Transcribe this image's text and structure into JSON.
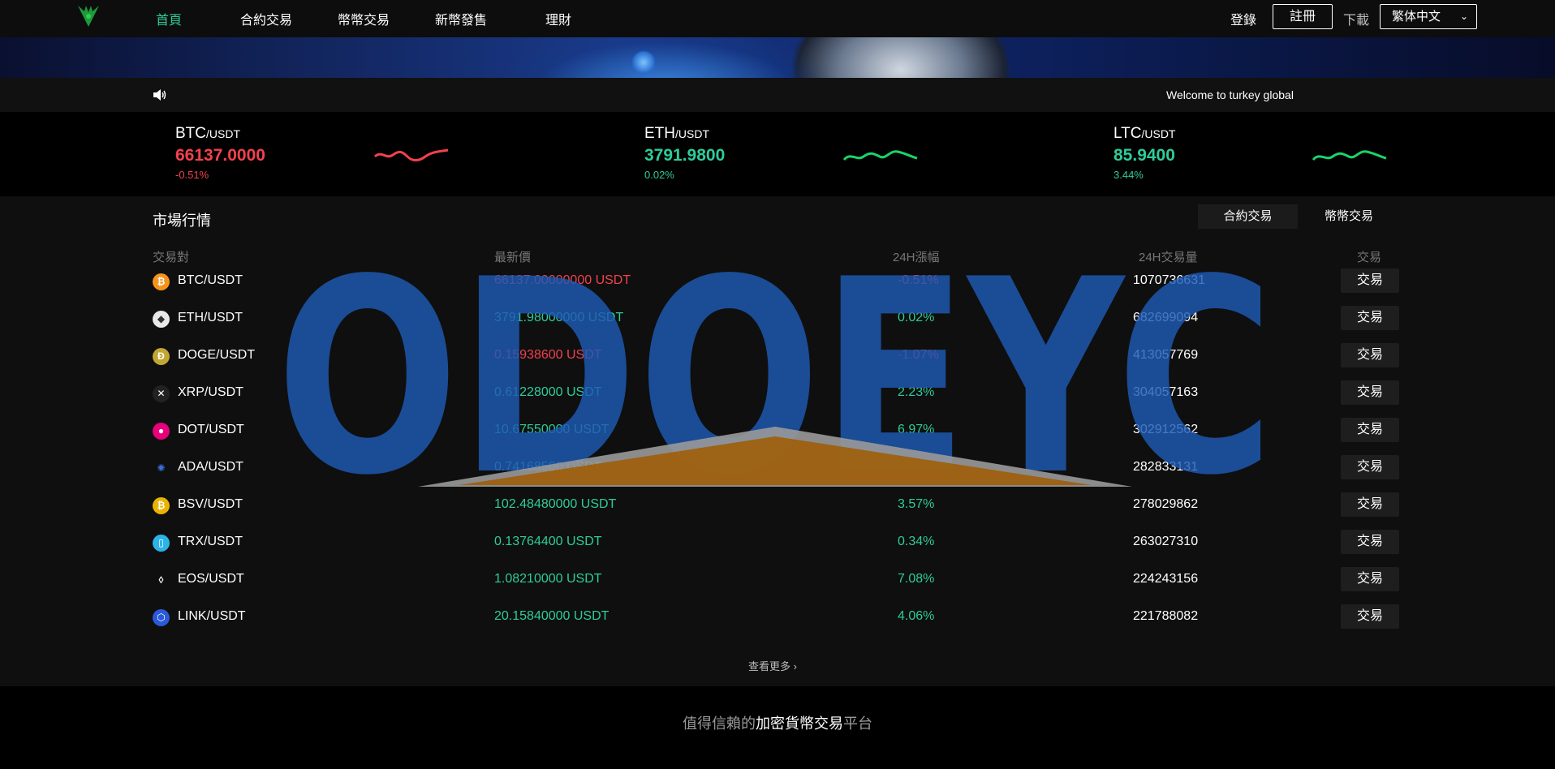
{
  "nav": {
    "items": [
      "首頁",
      "合約交易",
      "幣幣交易",
      "新幣發售",
      "理財"
    ],
    "login": "登錄",
    "register": "註冊",
    "download": "下載",
    "language": "繁体中文"
  },
  "notice": {
    "text": "Welcome to turkey global"
  },
  "tickers": [
    {
      "base": "BTC",
      "quote": "/USDT",
      "price": "66137.0000",
      "change": "-0.51%",
      "trend": "down"
    },
    {
      "base": "ETH",
      "quote": "/USDT",
      "price": "3791.9800",
      "change": "0.02%",
      "trend": "up"
    },
    {
      "base": "LTC",
      "quote": "/USDT",
      "price": "85.9400",
      "change": "3.44%",
      "trend": "up"
    }
  ],
  "market": {
    "title": "市場行情",
    "tabs": [
      "合約交易",
      "幣幣交易"
    ],
    "headers": [
      "交易對",
      "最新價",
      "24H漲幅",
      "24H交易量",
      "交易"
    ],
    "rows": [
      {
        "pair": "BTC/USDT",
        "price": "66137.00000000 USDT",
        "change": "-0.51%",
        "volume": "1070736631",
        "action": "交易",
        "icon": "bitcoin-icon",
        "trend": "down"
      },
      {
        "pair": "ETH/USDT",
        "price": "3791.98000000 USDT",
        "change": "0.02%",
        "volume": "682699094",
        "action": "交易",
        "icon": "ethereum-icon",
        "trend": "up"
      },
      {
        "pair": "DOGE/USDT",
        "price": "0.15938600 USDT",
        "change": "-1.07%",
        "volume": "413057769",
        "action": "交易",
        "icon": "dogecoin-icon",
        "trend": "down"
      },
      {
        "pair": "XRP/USDT",
        "price": "0.61228000 USDT",
        "change": "2.23%",
        "volume": "304057163",
        "action": "交易",
        "icon": "xrp-icon",
        "trend": "up"
      },
      {
        "pair": "DOT/USDT",
        "price": "10.67550000 USDT",
        "change": "6.97%",
        "volume": "302912562",
        "action": "交易",
        "icon": "polkadot-icon",
        "trend": "up"
      },
      {
        "pair": "ADA/USDT",
        "price": "0.74168500 USDT",
        "change": "3.37%",
        "volume": "282833131",
        "action": "交易",
        "icon": "cardano-icon",
        "trend": "up"
      },
      {
        "pair": "BSV/USDT",
        "price": "102.48480000 USDT",
        "change": "3.57%",
        "volume": "278029862",
        "action": "交易",
        "icon": "bsv-icon",
        "trend": "up"
      },
      {
        "pair": "TRX/USDT",
        "price": "0.13764400 USDT",
        "change": "0.34%",
        "volume": "263027310",
        "action": "交易",
        "icon": "tron-icon",
        "trend": "up"
      },
      {
        "pair": "EOS/USDT",
        "price": "1.08210000 USDT",
        "change": "7.08%",
        "volume": "224243156",
        "action": "交易",
        "icon": "eos-icon",
        "trend": "up"
      },
      {
        "pair": "LINK/USDT",
        "price": "20.15840000 USDT",
        "change": "4.06%",
        "volume": "221788082",
        "action": "交易",
        "icon": "chainlink-icon",
        "trend": "up"
      }
    ],
    "more": "查看更多"
  },
  "footer": {
    "tag_pre": "值得信賴的",
    "tag_strong": "加密貨幣交易",
    "tag_post": "平台"
  },
  "watermark": {
    "text": "ODOEYC"
  },
  "colors": {
    "up": "#2ecc9a",
    "down": "#f3414d",
    "nav_active": "#2ecc9a"
  }
}
